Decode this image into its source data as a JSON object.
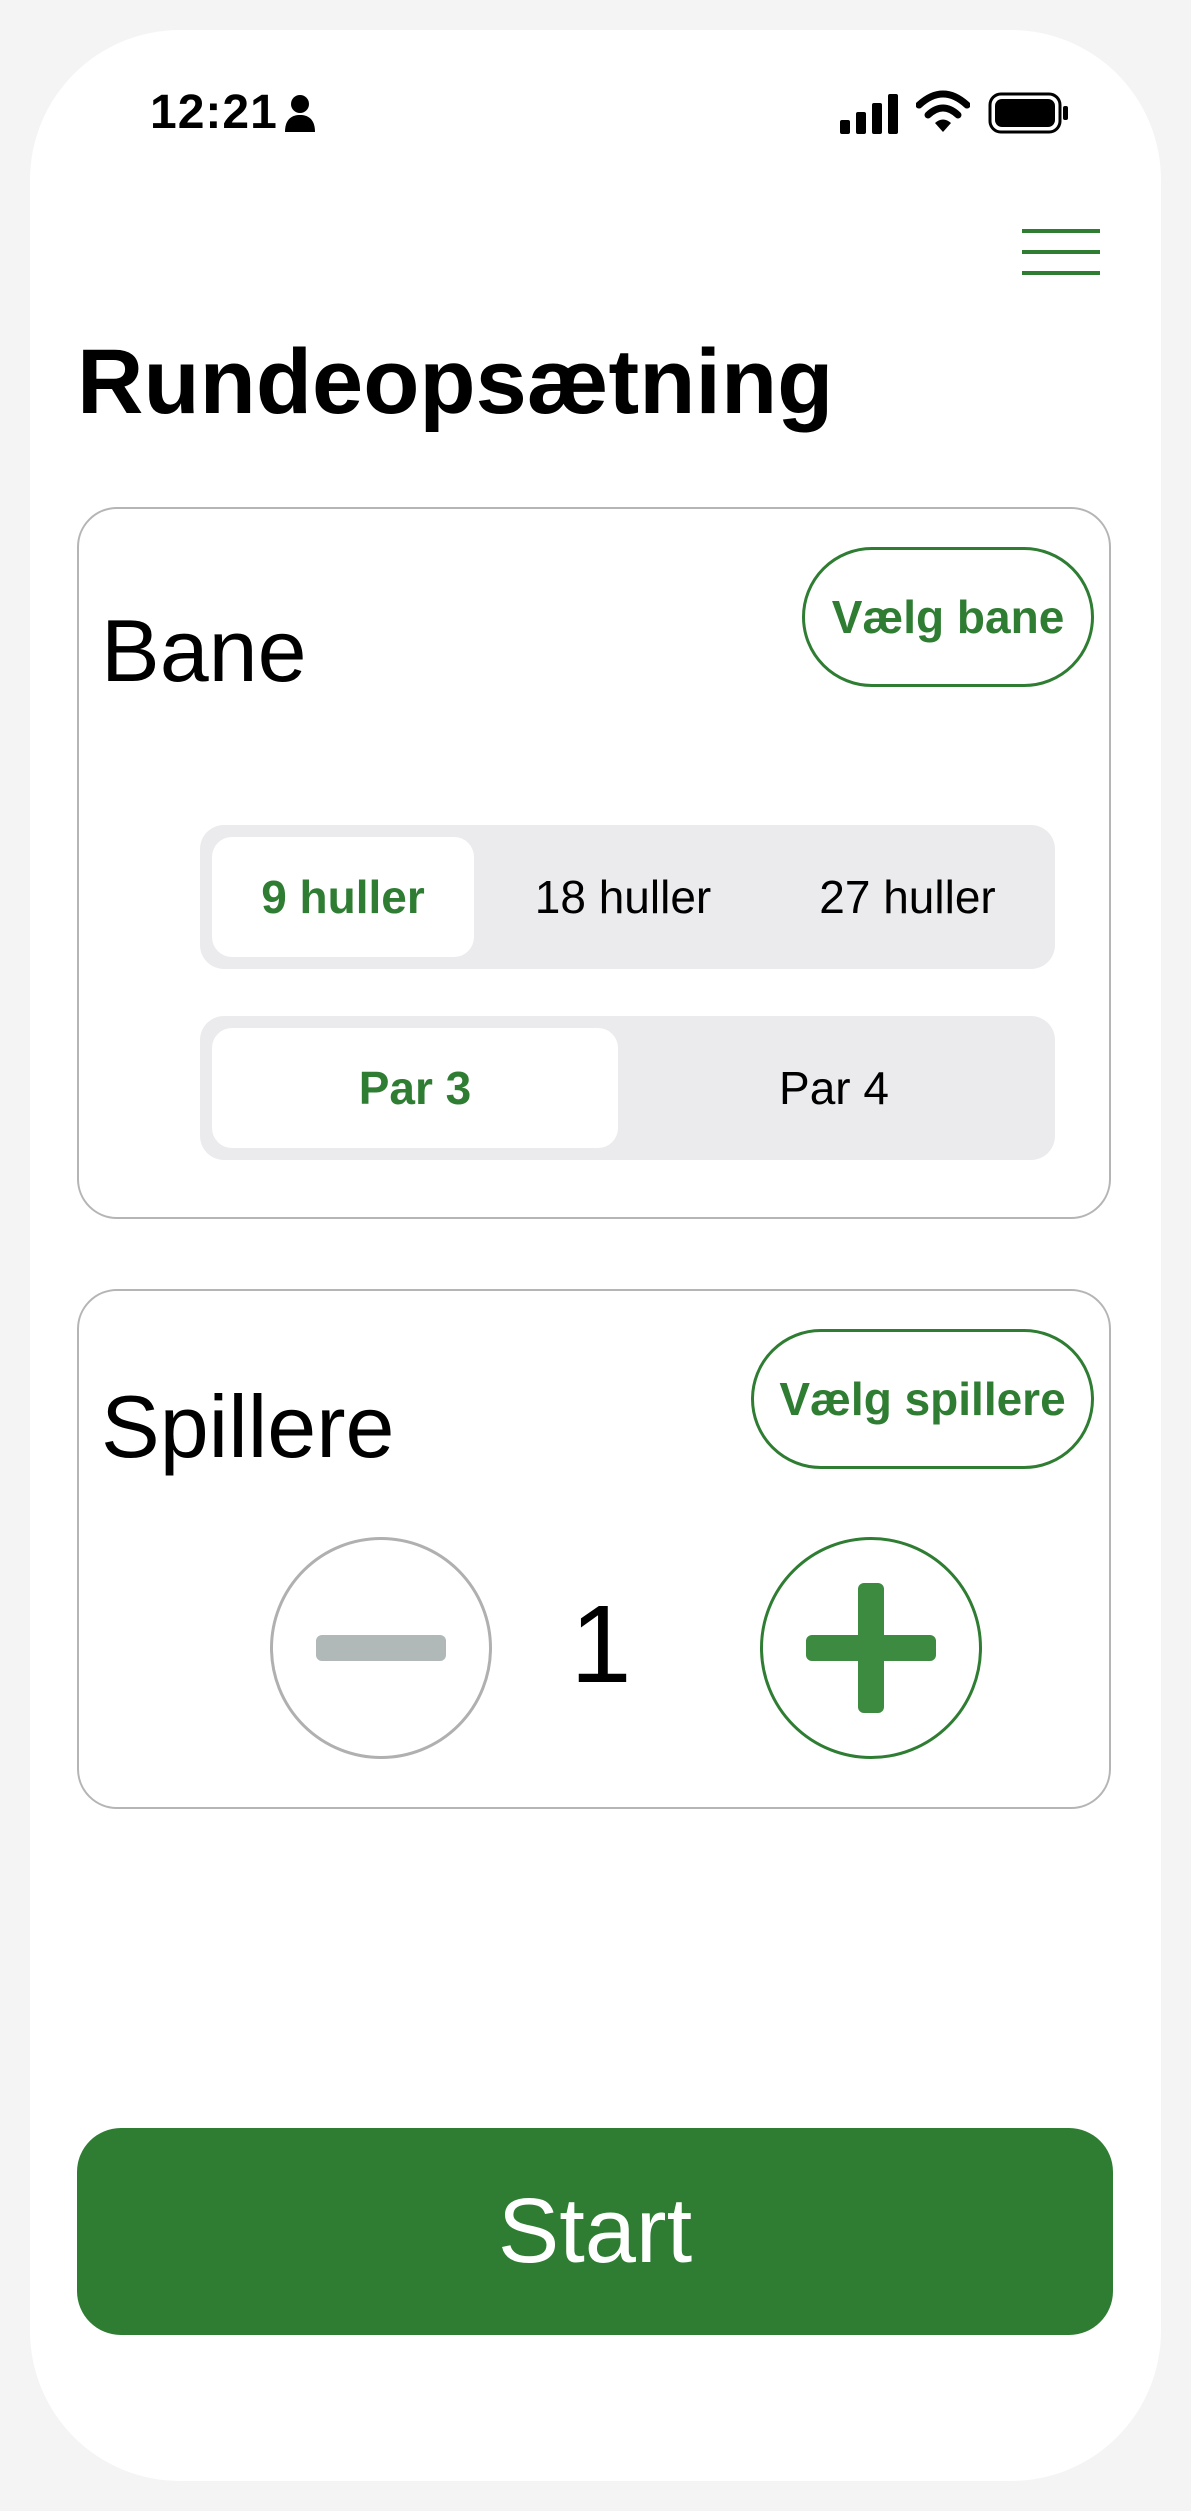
{
  "status_bar": {
    "time": "12:21"
  },
  "page": {
    "title": "Rundeopsætning"
  },
  "course_card": {
    "title": "Bane",
    "choose_label": "Vælg bane",
    "holes_options": [
      "9 huller",
      "18 huller",
      "27 huller"
    ],
    "holes_selected": "9 huller",
    "par_options": [
      "Par 3",
      "Par 4"
    ],
    "par_selected": "Par 3"
  },
  "players_card": {
    "title": "Spillere",
    "choose_label": "Vælg spillere",
    "count": "1"
  },
  "footer": {
    "start_label": "Start"
  },
  "colors": {
    "accent": "#2e7d32",
    "segment_bg": "#ebebed",
    "card_border": "#b5b5b5",
    "disabled": "#b0b8b8"
  }
}
